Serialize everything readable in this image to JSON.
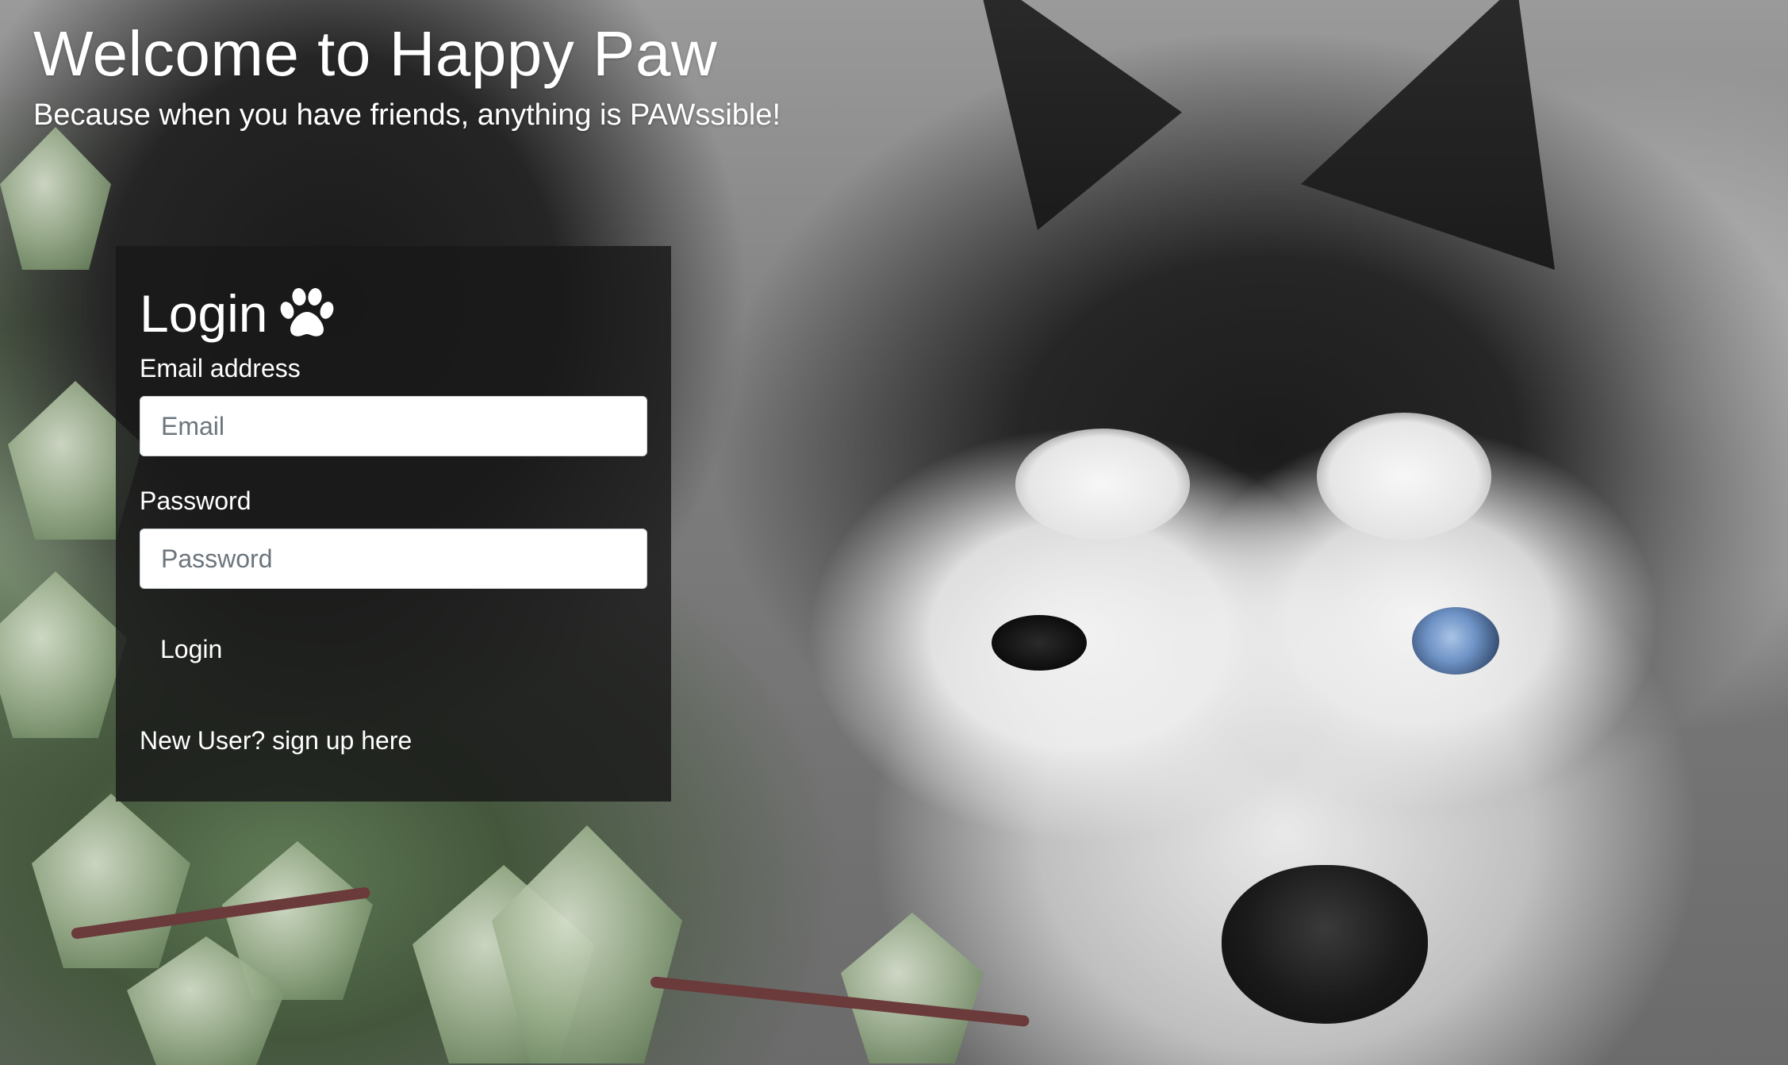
{
  "header": {
    "title": "Welcome to Happy Paw",
    "tagline": "Because when you have friends, anything is PAWssible!"
  },
  "login": {
    "heading": "Login",
    "heading_icon": "paw-icon",
    "email": {
      "label": "Email address",
      "value": "",
      "placeholder": "Email"
    },
    "password": {
      "label": "Password",
      "value": "",
      "placeholder": "Password"
    },
    "submit_label": "Login",
    "signup_link": "New User? sign up here"
  },
  "colors": {
    "text": "#ffffff",
    "card_background": "rgba(25,25,25,0.82)",
    "input_background": "#ffffff",
    "placeholder": "#6c757d",
    "husky_eye": "#6e93c6"
  }
}
